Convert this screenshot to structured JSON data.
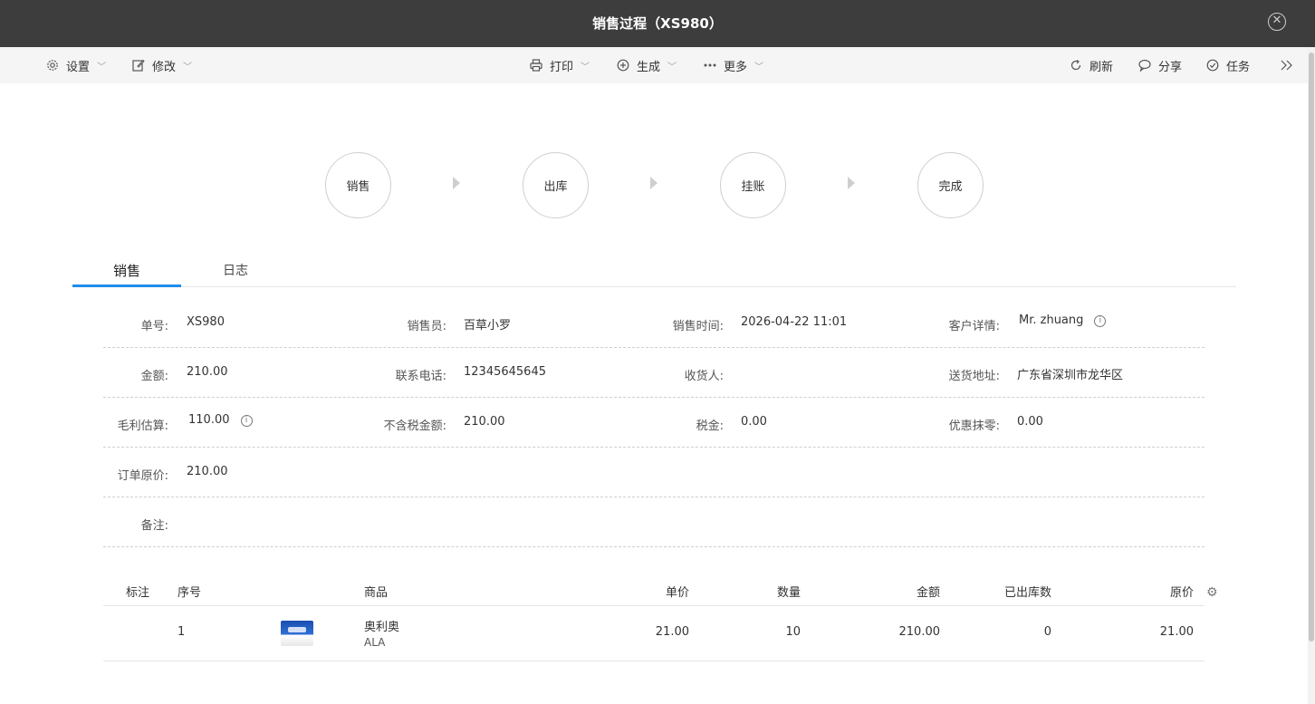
{
  "window": {
    "title": "销售过程（XS980）"
  },
  "toolbar": {
    "settings": "设置",
    "edit": "修改",
    "print": "打印",
    "generate": "生成",
    "more": "更多",
    "refresh": "刷新",
    "share": "分享",
    "task": "任务"
  },
  "steps": [
    "销售",
    "出库",
    "挂账",
    "完成"
  ],
  "tabs": [
    "销售",
    "日志"
  ],
  "fields": {
    "order_no": {
      "label": "单号:",
      "value": "XS980"
    },
    "salesperson": {
      "label": "销售员:",
      "value": "百草小罗"
    },
    "sale_time": {
      "label": "销售时间:",
      "value": "2026-04-22 11:01"
    },
    "customer": {
      "label": "客户详情:",
      "value": "Mr. zhuang"
    },
    "amount": {
      "label": "金额:",
      "value": "210.00"
    },
    "phone": {
      "label": "联系电话:",
      "value": "12345645645"
    },
    "receiver": {
      "label": "收货人:",
      "value": ""
    },
    "address": {
      "label": "送货地址:",
      "value": "广东省深圳市龙华区"
    },
    "gross_profit": {
      "label": "毛利估算:",
      "value": "110.00"
    },
    "pretax_amount": {
      "label": "不含税金额:",
      "value": "210.00"
    },
    "tax": {
      "label": "税金:",
      "value": "0.00"
    },
    "discount": {
      "label": "优惠抹零:",
      "value": "0.00"
    },
    "original_price": {
      "label": "订单原价:",
      "value": "210.00"
    },
    "remark": {
      "label": "备注:",
      "value": ""
    }
  },
  "table": {
    "headers": [
      "标注",
      "序号",
      "商品",
      "单价",
      "数量",
      "金额",
      "已出库数",
      "原价"
    ],
    "rows": [
      {
        "mark": "",
        "index": "1",
        "name": "奥利奥",
        "code": "ALA",
        "price": "21.00",
        "qty": "10",
        "amount": "210.00",
        "shipped": "0",
        "original": "21.00"
      }
    ]
  }
}
